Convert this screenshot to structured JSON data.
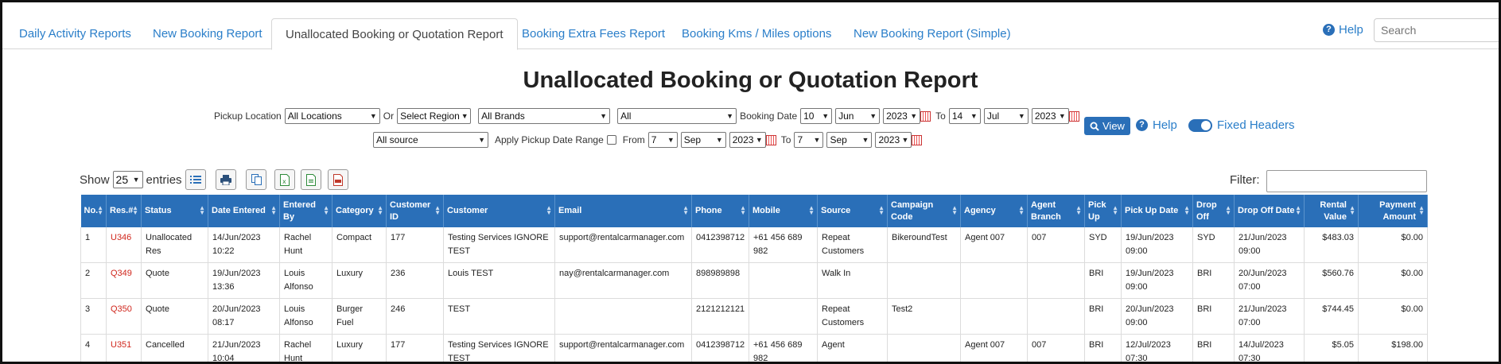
{
  "tabs": [
    {
      "label": "Daily Activity Reports",
      "active": false
    },
    {
      "label": "New Booking Report",
      "active": false
    },
    {
      "label": "Unallocated Booking or Quotation Report",
      "active": true
    },
    {
      "label": "Booking Extra Fees Report",
      "active": false
    },
    {
      "label": "Booking Kms / Miles options",
      "active": false
    },
    {
      "label": "New Booking Report (Simple)",
      "active": false
    }
  ],
  "header": {
    "help_label": "Help",
    "search_placeholder": "Search"
  },
  "page_title": "Unallocated Booking or Quotation Report",
  "filters": {
    "pickup_location_label": "Pickup Location",
    "pickup_location": "All Locations",
    "or_label": "Or",
    "region": "Select Region",
    "brands": "All Brands",
    "all": "All",
    "booking_date_label": "Booking Date",
    "from_day": "10",
    "from_month": "Jun",
    "from_year": "2023",
    "to_label": "To",
    "to_day": "14",
    "to_month": "Jul",
    "to_year": "2023",
    "source": "All source",
    "apply_pickup_label": "Apply Pickup Date Range",
    "pickup_from_label": "From",
    "pickup_from_day": "7",
    "pickup_from_month": "Sep",
    "pickup_from_year": "2023",
    "pickup_to_label": "To",
    "pickup_to_day": "7",
    "pickup_to_month": "Sep",
    "pickup_to_year": "2023",
    "view_label": "View",
    "help_label": "Help",
    "fixed_headers_label": "Fixed Headers"
  },
  "table_controls": {
    "show_label": "Show",
    "entries_value": "25",
    "entries_label": "entries",
    "filter_label": "Filter:"
  },
  "table": {
    "headers": [
      "No.",
      "Res.#",
      "Status",
      "Date Entered",
      "Entered By",
      "Category",
      "Customer ID",
      "Customer",
      "Email",
      "Phone",
      "Mobile",
      "Source",
      "Campaign Code",
      "Agency",
      "Agent Branch",
      "Pick Up",
      "Pick Up Date",
      "Drop Off",
      "Drop Off Date",
      "Rental Value",
      "Payment Amount"
    ],
    "rows": [
      [
        "1",
        "U346",
        "Unallocated Res",
        "14/Jun/2023 10:22",
        "Rachel Hunt",
        "Compact",
        "177",
        "Testing Services IGNORE TEST",
        "support@rentalcarmanager.com",
        "0412398712",
        "+61 456 689 982",
        "Repeat Customers",
        "BikeroundTest",
        "Agent 007",
        "007",
        "SYD",
        "19/Jun/2023 09:00",
        "SYD",
        "21/Jun/2023 09:00",
        "$483.03",
        "$0.00"
      ],
      [
        "2",
        "Q349",
        "Quote",
        "19/Jun/2023 13:36",
        "Louis Alfonso",
        "Luxury",
        "236",
        "Louis TEST",
        "nay@rentalcarmanager.com",
        "898989898",
        "",
        "Walk In",
        "",
        "",
        "",
        "BRI",
        "19/Jun/2023 09:00",
        "BRI",
        "20/Jun/2023 07:00",
        "$560.76",
        "$0.00"
      ],
      [
        "3",
        "Q350",
        "Quote",
        "20/Jun/2023 08:17",
        "Louis Alfonso",
        "Burger Fuel",
        "246",
        "TEST",
        "",
        "2121212121",
        "",
        "Repeat Customers",
        "Test2",
        "",
        "",
        "BRI",
        "20/Jun/2023 09:00",
        "BRI",
        "21/Jun/2023 07:00",
        "$744.45",
        "$0.00"
      ],
      [
        "4",
        "U351",
        "Cancelled",
        "21/Jun/2023 10:04",
        "Rachel Hunt",
        "Luxury",
        "177",
        "Testing Services IGNORE TEST",
        "support@rentalcarmanager.com",
        "0412398712",
        "+61 456 689 982",
        "Agent",
        "",
        "Agent 007",
        "007",
        "BRI",
        "12/Jul/2023 07:30",
        "BRI",
        "14/Jul/2023 07:30",
        "$5.05",
        "$198.00"
      ]
    ]
  }
}
